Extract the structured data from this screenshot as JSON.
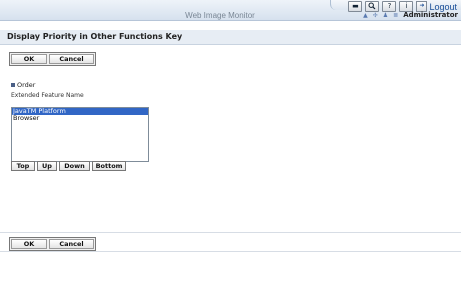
{
  "header": {
    "app_title": "Web Image Monitor",
    "icons": [
      "monitor-icon",
      "search-icon",
      "help-icon",
      "info-icon"
    ],
    "icon_glyphs": [
      "▬",
      "🔍",
      "?",
      "i"
    ],
    "logout_label": "Logout",
    "user_name": "Administrator"
  },
  "page": {
    "title": "Display Priority in Other Functions Key"
  },
  "top_buttons": {
    "ok": "OK",
    "cancel": "Cancel"
  },
  "bottom_buttons": {
    "ok": "OK",
    "cancel": "Cancel"
  },
  "order_section": {
    "label": "Order",
    "field_label": "Extended Feature Name",
    "items": [
      {
        "label": "JavaTM Platform",
        "selected": true
      },
      {
        "label": "Browser",
        "selected": false
      }
    ],
    "buttons": {
      "top": "Top",
      "up": "Up",
      "down": "Down",
      "bottom": "Bottom"
    }
  }
}
